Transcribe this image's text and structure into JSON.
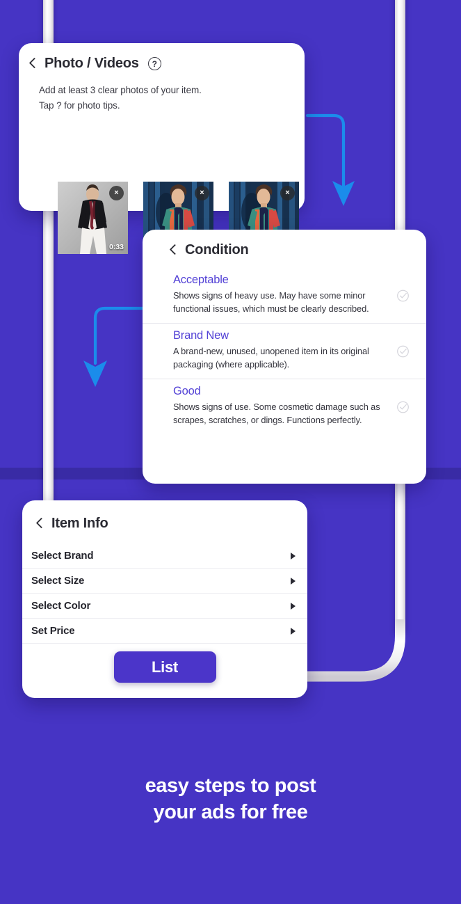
{
  "theme": {
    "background": "#4634c4",
    "band": "#372aa0",
    "accent_purple": "#5342d6",
    "button_purple": "#4b35c9",
    "arrow_blue": "#1b8ceb",
    "tube_white": "#f4f3f5"
  },
  "photos_card": {
    "back_icon": "chevron-left-icon",
    "title": "Photo / Videos",
    "help_icon": "?",
    "subtitle_line1": "Add at least 3 clear photos of your item.",
    "subtitle_line2": "Tap ? for photo tips.",
    "thumbnails": [
      {
        "alt": "man in black blazer and white trousers",
        "remove_label": "×",
        "duration": "0:33",
        "has_duration": true
      },
      {
        "alt": "man in striped polo shirt against blue curtain",
        "remove_label": "×",
        "duration": "",
        "has_duration": false
      },
      {
        "alt": "man in striped polo shirt against blue curtain",
        "remove_label": "×",
        "duration": "",
        "has_duration": false
      }
    ]
  },
  "condition_card": {
    "back_icon": "chevron-left-icon",
    "title": "Condition",
    "options": [
      {
        "name": "Acceptable",
        "description": "Shows signs of heavy use. May have some minor functional issues, which must be clearly described.",
        "check_icon": "check-circle-icon",
        "selected": false
      },
      {
        "name": "Brand New",
        "description": "A brand-new, unused, unopened item in its original packaging (where applicable).",
        "check_icon": "check-circle-icon",
        "selected": false
      },
      {
        "name": "Good",
        "description": "Shows signs of use. Some cosmetic damage such as scrapes, scratches, or dings. Functions perfectly.",
        "check_icon": "check-circle-icon",
        "selected": false
      }
    ]
  },
  "item_info_card": {
    "back_icon": "chevron-left-icon",
    "title": "Item Info",
    "rows": [
      {
        "label": "Select Brand",
        "caret": "caret-right-icon"
      },
      {
        "label": "Select Size",
        "caret": "caret-right-icon"
      },
      {
        "label": "Select Color",
        "caret": "caret-right-icon"
      },
      {
        "label": "Set Price",
        "caret": "caret-right-icon"
      }
    ],
    "submit_label": "List"
  },
  "tagline": {
    "line1": "easy steps to post",
    "line2": "your ads for free"
  }
}
